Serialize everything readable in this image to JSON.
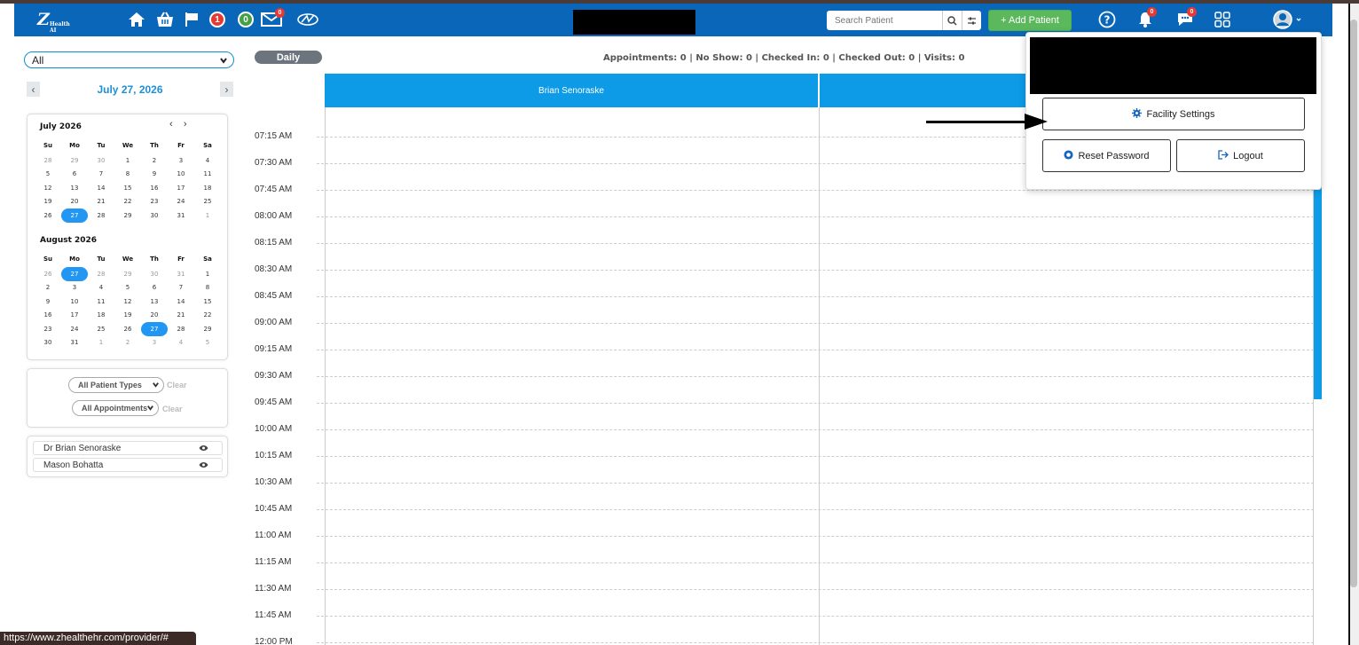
{
  "header": {
    "logo_text": "Z",
    "logo_sub": "Health AI",
    "flag_badge": "1",
    "green_badge": "0",
    "mail_badge": "0",
    "search_placeholder": "Search Patient",
    "add_patient_label": "+ Add Patient",
    "bell_badge": "0",
    "chat_badge": "0",
    "colors": {
      "header_bg": "#0a66b8",
      "add_btn": "#5cb85c",
      "badge_red": "#e53935",
      "badge_green": "#43a047"
    }
  },
  "left": {
    "provider_filter": "All",
    "date_label": "July 27, 2026",
    "calendars": [
      {
        "title": "July 2026",
        "weekdays": [
          "Su",
          "Mo",
          "Tu",
          "We",
          "Th",
          "Fr",
          "Sa"
        ],
        "days": [
          [
            "28",
            "29",
            "30",
            "1",
            "2",
            "3",
            "4"
          ],
          [
            "5",
            "6",
            "7",
            "8",
            "9",
            "10",
            "11"
          ],
          [
            "12",
            "13",
            "14",
            "15",
            "16",
            "17",
            "18"
          ],
          [
            "19",
            "20",
            "21",
            "22",
            "23",
            "24",
            "25"
          ],
          [
            "26",
            "27",
            "28",
            "29",
            "30",
            "31",
            "1"
          ]
        ]
      },
      {
        "title": "August 2026",
        "weekdays": [
          "Su",
          "Mo",
          "Tu",
          "We",
          "Th",
          "Fr",
          "Sa"
        ],
        "days": [
          [
            "26",
            "27",
            "28",
            "29",
            "30",
            "31",
            "1"
          ],
          [
            "2",
            "3",
            "4",
            "5",
            "6",
            "7",
            "8"
          ],
          [
            "9",
            "10",
            "11",
            "12",
            "13",
            "14",
            "15"
          ],
          [
            "16",
            "17",
            "18",
            "19",
            "20",
            "21",
            "22"
          ],
          [
            "23",
            "24",
            "25",
            "26",
            "27",
            "28",
            "29"
          ],
          [
            "30",
            "31",
            "1",
            "2",
            "3",
            "4",
            "5"
          ]
        ]
      }
    ],
    "patient_types": "All Patient Types",
    "appointments_filter": "All Appointments",
    "clear_label": "Clear",
    "providers": [
      "Dr Brian Senoraske",
      "Mason Bohatta"
    ]
  },
  "main": {
    "view_label": "Daily",
    "summary": "Appointments: 0  | No Show: 0  |  Checked In: 0  |  Checked Out: 0  |  Visits: 0",
    "columns": [
      "Brian Senoraske"
    ],
    "times": [
      "07:15 AM",
      "07:30 AM",
      "07:45 AM",
      "08:00 AM",
      "08:15 AM",
      "08:30 AM",
      "08:45 AM",
      "09:00 AM",
      "09:15 AM",
      "09:30 AM",
      "09:45 AM",
      "10:00 AM",
      "10:15 AM",
      "10:30 AM",
      "10:45 AM",
      "11:00 AM",
      "11:15 AM",
      "11:30 AM",
      "11:45 AM",
      "12:00 PM"
    ]
  },
  "dropdown": {
    "facility_settings": "Facility Settings",
    "reset_password": "Reset Password",
    "logout": "Logout"
  },
  "status_url": "https://www.zhealthehr.com/provider/#"
}
